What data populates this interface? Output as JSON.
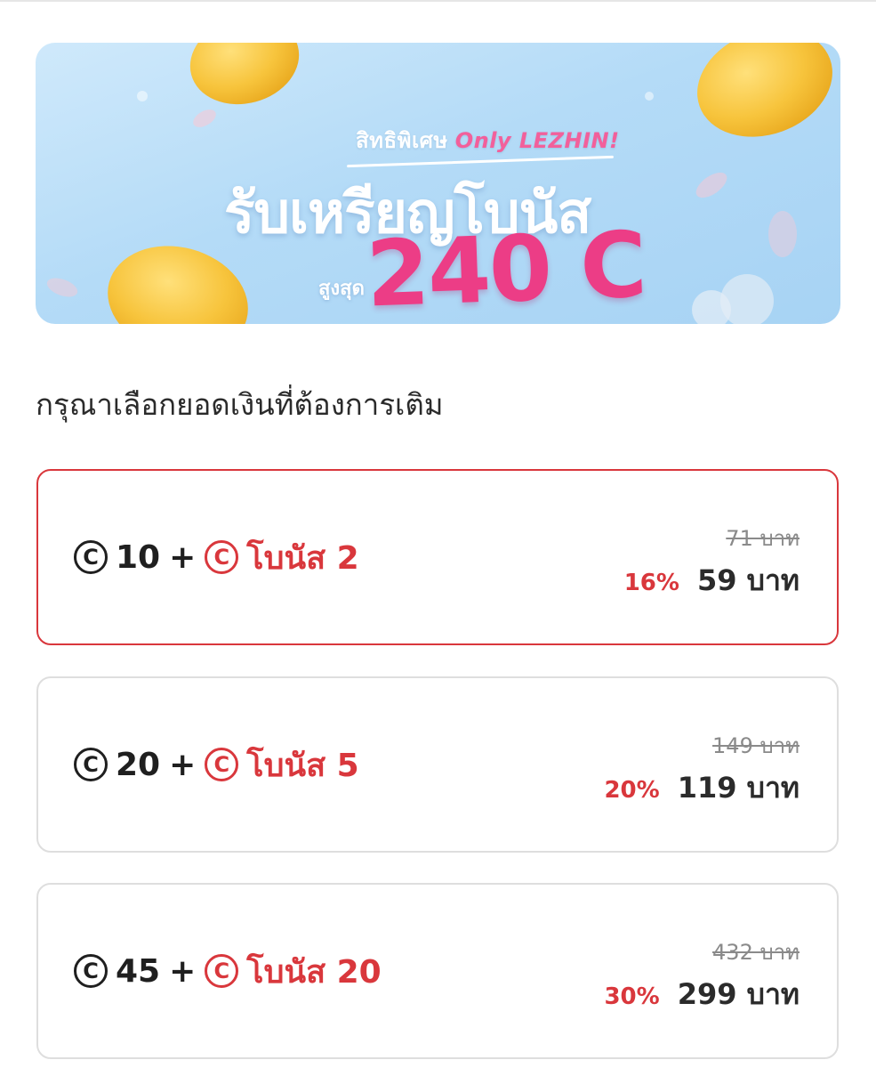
{
  "banner": {
    "tagline": "สิทธิพิเศษ",
    "tagline_accent": "Only LEZHIN!",
    "headline": "รับเหรียญโบนัส",
    "max_label": "สูงสุด",
    "amount": "240 C"
  },
  "section_title": "กรุณาเลือกยอดเงินที่ต้องการเติม",
  "coin_symbol": "C",
  "options": [
    {
      "coins": "10",
      "plus": "+",
      "bonus": "โบนัส 2",
      "original_price": "71 บาท",
      "discount": "16%",
      "price": "59 บาท",
      "selected": true
    },
    {
      "coins": "20",
      "plus": "+",
      "bonus": "โบนัส 5",
      "original_price": "149 บาท",
      "discount": "20%",
      "price": "119 บาท",
      "selected": false
    },
    {
      "coins": "45",
      "plus": "+",
      "bonus": "โบนัส 20",
      "original_price": "432 บาท",
      "discount": "30%",
      "price": "299 บาท",
      "selected": false
    }
  ],
  "colors": {
    "accent_red": "#d9373c",
    "banner_pink": "#ec3d86",
    "banner_blue": "#b4dbf7"
  }
}
